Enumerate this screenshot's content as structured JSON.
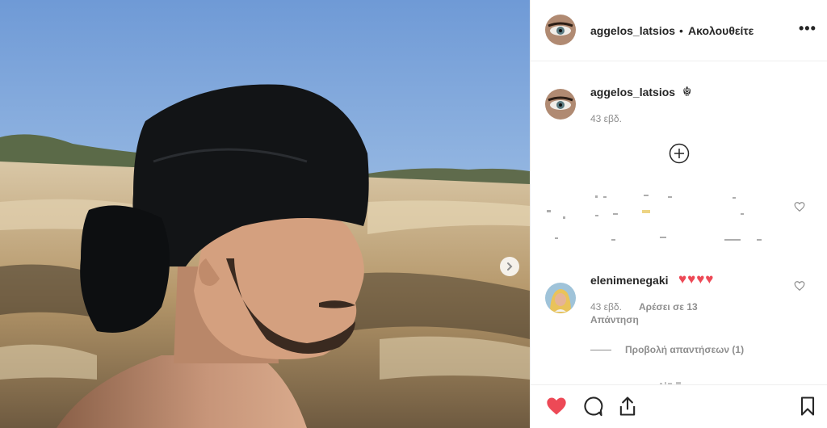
{
  "post": {
    "username": "aggelos_latsios",
    "separator": "•",
    "follow_status": "Ακολουθείτε",
    "more_icon": "more-options-icon"
  },
  "caption": {
    "username": "aggelos_latsios",
    "emoji": "☬",
    "time": "43 εβδ."
  },
  "comments": [
    {
      "username": "elenimenegaki",
      "text": "♥♥♥♥",
      "time": "43 εβδ.",
      "likes": "Αρέσει σε 13",
      "reply": "Απάντηση",
      "view_replies": "Προβολή απαντήσεων (1)"
    }
  ],
  "colors": {
    "like_active": "#ed4956",
    "muted_text": "#8e8e8e",
    "primary_text": "#262626",
    "sky": "#8eb6e0"
  },
  "icons": [
    "heart-icon",
    "comment-icon",
    "share-icon",
    "bookmark-icon",
    "add-circle-icon",
    "next-arrow-icon"
  ]
}
